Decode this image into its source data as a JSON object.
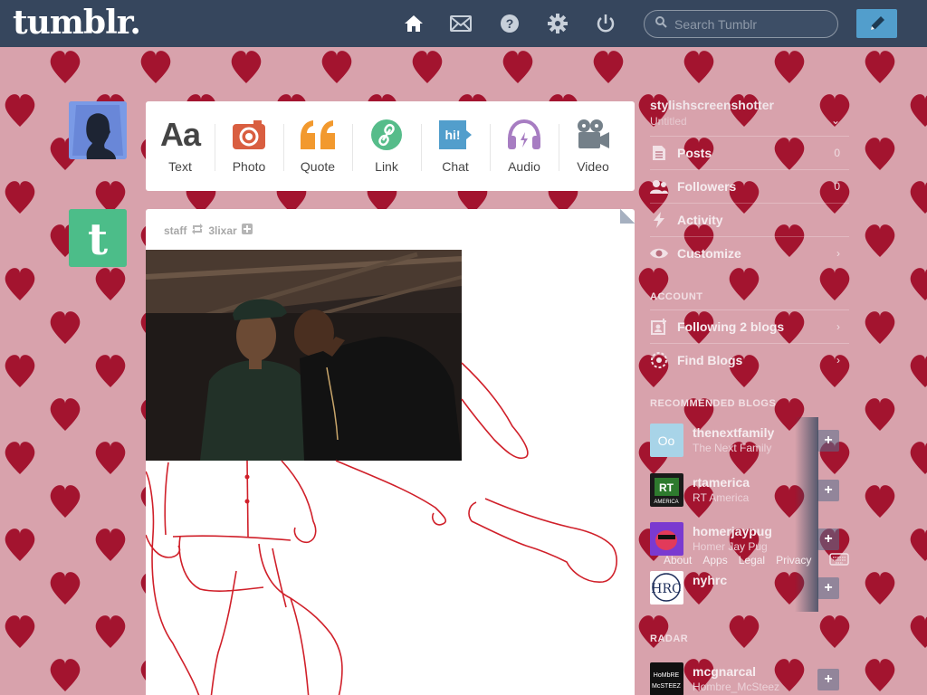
{
  "header": {
    "logo": "tumblr.",
    "search_placeholder": "Search Tumblr",
    "icons": [
      "home-icon",
      "mail-icon",
      "help-icon",
      "gear-icon",
      "power-icon"
    ]
  },
  "post_types": [
    {
      "label": "Text",
      "icon": "text-icon",
      "color": "#444444"
    },
    {
      "label": "Photo",
      "icon": "camera-icon",
      "color": "#d95e40"
    },
    {
      "label": "Quote",
      "icon": "quote-icon",
      "color": "#f2992e"
    },
    {
      "label": "Link",
      "icon": "link-icon",
      "color": "#56bc8a"
    },
    {
      "label": "Chat",
      "icon": "chat-icon",
      "color": "#529ecc"
    },
    {
      "label": "Audio",
      "icon": "headphones-icon",
      "color": "#a77dc2"
    },
    {
      "label": "Video",
      "icon": "video-camera-icon",
      "color": "#748089"
    }
  ],
  "post": {
    "author": "staff",
    "reblogged_from": "3lixar"
  },
  "sidebar": {
    "blog_name": "stylishscreenshotter",
    "blog_title": "Untitled",
    "items": [
      {
        "label": "Posts",
        "count": "0"
      },
      {
        "label": "Followers",
        "count": "0"
      },
      {
        "label": "Activity",
        "count": ""
      },
      {
        "label": "Customize",
        "count": ""
      }
    ],
    "account_heading": "ACCOUNT",
    "account_items": [
      {
        "label": "Following 2 blogs"
      },
      {
        "label": "Find Blogs"
      }
    ],
    "recommended_heading": "RECOMMENDED BLOGS",
    "recommended": [
      {
        "name": "thenextfamily",
        "title": "The Next Family"
      },
      {
        "name": "rtamerica",
        "title": "RT America"
      },
      {
        "name": "homerjaypug",
        "title": "Homer Jay Pug"
      },
      {
        "name": "nyhrc",
        "title": ""
      }
    ],
    "radar_heading": "RADAR",
    "radar": [
      {
        "name": "mcgnarcal",
        "title": "Hombre_McSteez"
      }
    ],
    "footer_links": [
      "About",
      "Apps",
      "Legal",
      "Privacy"
    ]
  },
  "colors": {
    "header_bg": "#36465d",
    "compose_button": "#529ecc",
    "background_hearts": "#9c1b33",
    "background": "#d9a0aa"
  }
}
